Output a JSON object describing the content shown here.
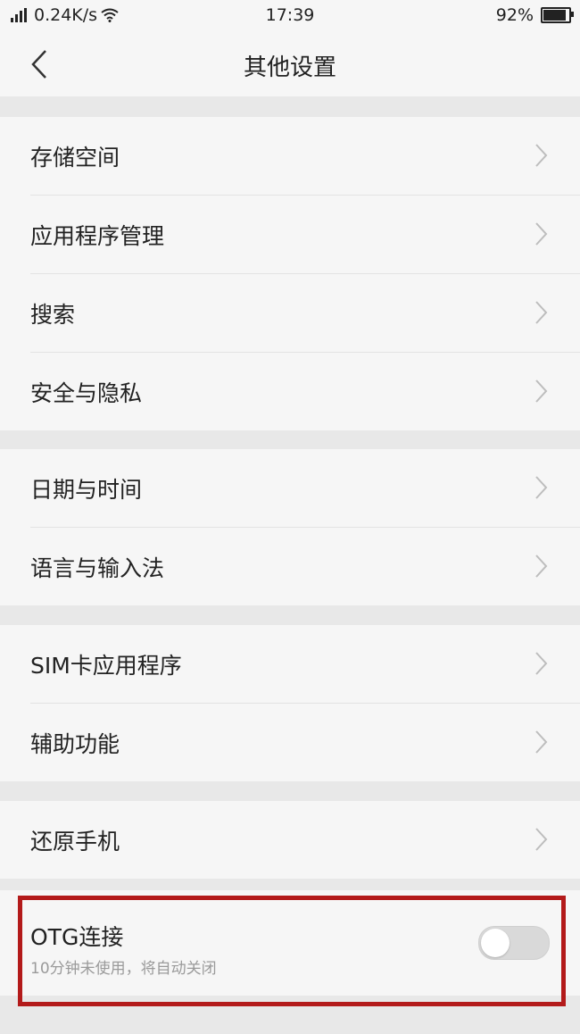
{
  "status_bar": {
    "network_speed": "0.24K/s",
    "time": "17:39",
    "battery_percent": "92%",
    "battery_level": 0.92,
    "icons": [
      "signal-icon",
      "wifi-icon",
      "battery-icon"
    ]
  },
  "header": {
    "title": "其他设置",
    "back_icon": "chevron-left-icon"
  },
  "groups": [
    {
      "items": [
        {
          "label": "存储空间"
        },
        {
          "label": "应用程序管理"
        },
        {
          "label": "搜索"
        },
        {
          "label": "安全与隐私"
        }
      ]
    },
    {
      "items": [
        {
          "label": "日期与时间"
        },
        {
          "label": "语言与输入法"
        }
      ]
    },
    {
      "items": [
        {
          "label": "SIM卡应用程序"
        },
        {
          "label": "辅助功能"
        }
      ]
    },
    {
      "items": [
        {
          "label": "还原手机"
        }
      ]
    }
  ],
  "otg": {
    "title": "OTG连接",
    "subtitle": "10分钟未使用，将自动关闭",
    "enabled": false
  },
  "colors": {
    "highlight": "#b31a1a",
    "background": "#e8e8e8",
    "panel": "#f6f6f6"
  }
}
